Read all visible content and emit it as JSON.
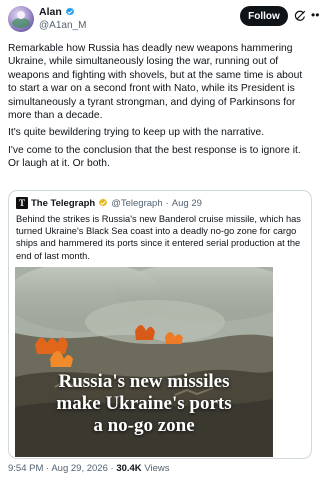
{
  "author": {
    "name": "Alan",
    "handle": "@A1an_M",
    "follow_label": "Follow"
  },
  "tweet": {
    "paragraphs": [
      "Remarkable how Russia has deadly new weapons hammering Ukraine, while simultaneously losing the war, running out of weapons and fighting with shovels, but at the same time is about to start a war on a second front with Nato, while its President is simultaneously a tyrant strongman, and dying of Parkinsons for more than a decade.",
      "It's quite bewildering trying to keep up with the narrative.",
      "I've come to the conclusion that the best response is to ignore it. Or laugh at it. Or both."
    ]
  },
  "quote": {
    "source_name": "The Telegraph",
    "source_handle": "@Telegraph",
    "separator": "·",
    "date": "Aug 29",
    "logo_letter": "T",
    "text": "Behind the strikes is Russia's new Banderol cruise missile, which has turned Ukraine's Black Sea coast into a deadly no-go zone for cargo ships and hammered its ports since it entered serial production at the end of last month.",
    "image_headline_lines": [
      "Russia's new missiles",
      "make Ukraine's ports",
      "a no-go zone"
    ]
  },
  "footer": {
    "time": "9:54 PM",
    "separator": "·",
    "date": "Aug 29, 2026",
    "views_count": "30.4K",
    "views_label": "Views"
  },
  "colors": {
    "verified_blue": "#1d9bf0",
    "verified_gold": "#e2b719",
    "text": "#0f1419",
    "muted": "#536471",
    "border": "#cfd9de"
  },
  "icons": [
    "verified-badge-icon",
    "grok-icon",
    "more-icon",
    "gold-verified-badge-icon"
  ]
}
